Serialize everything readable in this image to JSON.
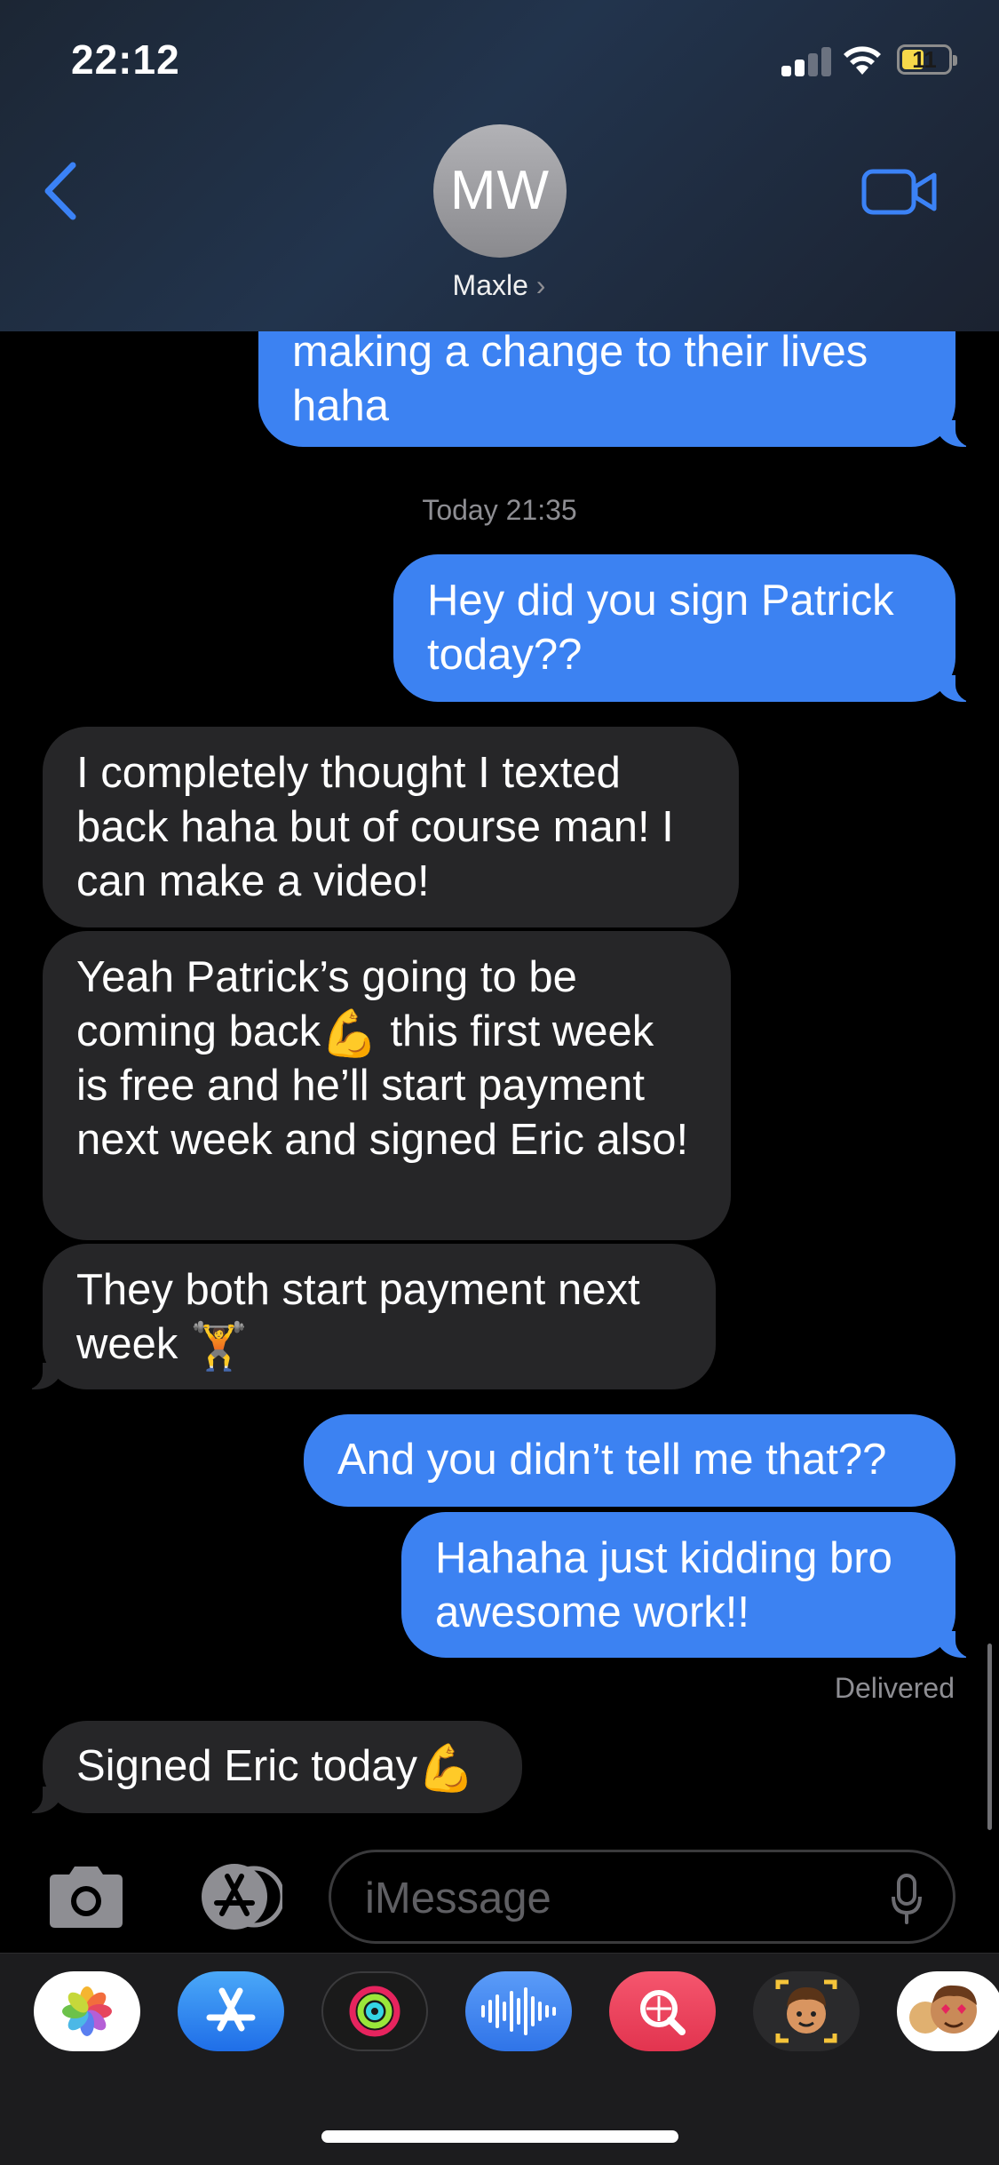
{
  "status_bar": {
    "time": "22:12",
    "battery": "11"
  },
  "header": {
    "avatar_initials": "MW",
    "contact_name": "Maxle",
    "chevron": "›"
  },
  "messages": {
    "m0": "making a change to their lives haha",
    "timestamp": "Today 21:35",
    "m1": "Hey did you sign Patrick today??",
    "m2": "I completely thought I texted back haha but of course man! I can make a video!",
    "m3_a": "Yeah Patrick’s going to be coming back",
    "m3_emoji": "💪",
    "m3_b": " this first week is free and he’ll start payment next week and signed Eric also!",
    "m4_a": "They both start payment next week",
    "m4_emoji": "🏋",
    "m5": "And you didn’t tell me that??",
    "m6": "Hahaha just kidding bro awesome work!!",
    "delivered": "Delivered",
    "m7_a": "Signed Eric today",
    "m7_emoji": "💪"
  },
  "input": {
    "placeholder": "iMessage"
  },
  "drawer": {
    "apps": [
      "photos-icon",
      "app-store-icon",
      "activity-icon",
      "audio-message-icon",
      "images-search-icon",
      "memoji-icon",
      "memoji-stickers-icon"
    ]
  },
  "colors": {
    "sent_bubble": "#3c82f2",
    "received_bubble": "#262628",
    "accent": "#3b82f6"
  }
}
